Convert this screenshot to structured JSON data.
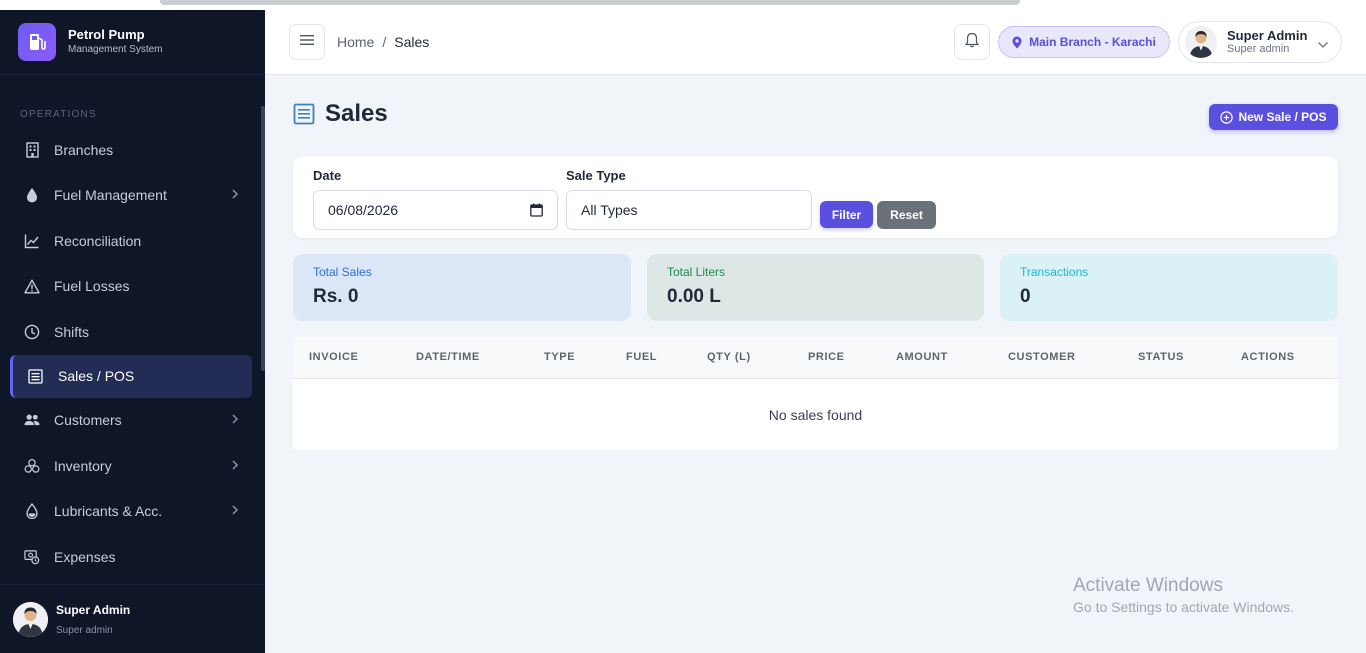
{
  "brand": {
    "title": "Petrol Pump",
    "subtitle": "Management System"
  },
  "sidebar": {
    "section_label": "OPERATIONS",
    "items": [
      {
        "label": "Branches",
        "icon": "building-icon"
      },
      {
        "label": "Fuel Management",
        "icon": "droplet-icon"
      },
      {
        "label": "Reconciliation",
        "icon": "chart-line-icon"
      },
      {
        "label": "Fuel Losses",
        "icon": "warning-icon"
      },
      {
        "label": "Shifts",
        "icon": "clock-icon"
      },
      {
        "label": "Sales / POS",
        "icon": "receipt-icon"
      },
      {
        "label": "Customers",
        "icon": "users-icon"
      },
      {
        "label": "Inventory",
        "icon": "boxes-icon"
      },
      {
        "label": "Lubricants & Acc.",
        "icon": "oil-drop-icon"
      },
      {
        "label": "Expenses",
        "icon": "cash-icon"
      }
    ],
    "footer": {
      "name": "Super Admin",
      "role": "Super admin"
    }
  },
  "header": {
    "breadcrumb": {
      "home": "Home",
      "separator": "/",
      "current": "Sales"
    },
    "branch": "Main Branch - Karachi",
    "user": {
      "name": "Super Admin",
      "role": "Super admin"
    }
  },
  "page": {
    "title": "Sales",
    "new_button": "New Sale / POS"
  },
  "filters": {
    "date_label": "Date",
    "date_value": "06/08/2026",
    "type_label": "Sale Type",
    "type_value": "All Types",
    "filter_button": "Filter",
    "reset_button": "Reset"
  },
  "stats": {
    "total_sales": {
      "label": "Total Sales",
      "value": "Rs. 0"
    },
    "total_liters": {
      "label": "Total Liters",
      "value": "0.00 L"
    },
    "transactions": {
      "label": "Transactions",
      "value": "0"
    }
  },
  "table": {
    "columns": [
      "INVOICE",
      "DATE/TIME",
      "TYPE",
      "FUEL",
      "QTY (L)",
      "PRICE",
      "AMOUNT",
      "CUSTOMER",
      "STATUS",
      "ACTIONS"
    ],
    "empty_message": "No sales found"
  },
  "watermark": {
    "line1": "Activate Windows",
    "line2": "Go to Settings to activate Windows."
  },
  "colors": {
    "accent": "#5b4fe0",
    "sidebar_bg": "#0e1628",
    "total_sales_bg": "#dbe6f7",
    "total_liters_bg": "#dde7e6",
    "transactions_bg": "#daf1f6"
  }
}
